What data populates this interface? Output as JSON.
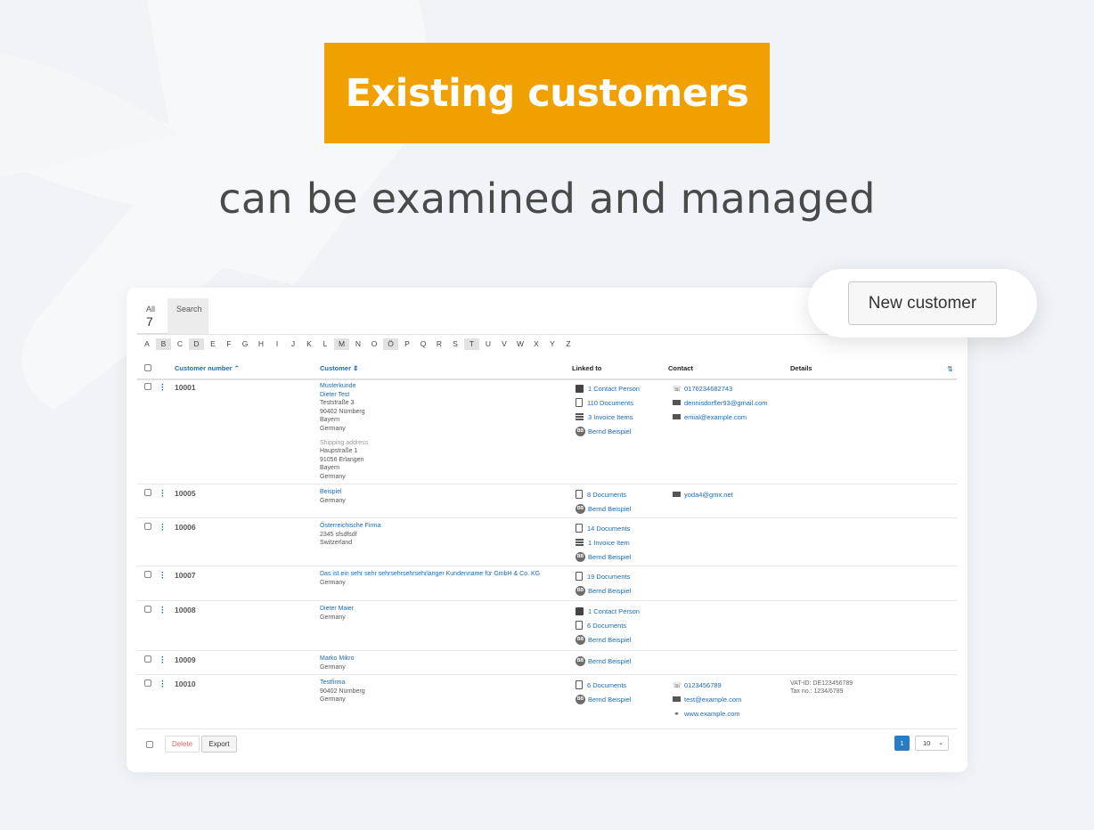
{
  "hero": {
    "title": "Existing customers",
    "subtitle": "can be examined and managed"
  },
  "colors": {
    "accent": "#f0a000",
    "link": "#1a6bb5",
    "primary_button": "#2a7bc4"
  },
  "new_customer_label": "New customer",
  "tabs": [
    {
      "label": "All",
      "count": "7"
    },
    {
      "label": "Search"
    }
  ],
  "letters": [
    "A",
    "B",
    "C",
    "D",
    "E",
    "F",
    "G",
    "H",
    "I",
    "J",
    "K",
    "L",
    "M",
    "N",
    "O",
    "Ö",
    "P",
    "Q",
    "R",
    "S",
    "T",
    "U",
    "V",
    "W",
    "X",
    "Y",
    "Z"
  ],
  "active_letters": [
    "B",
    "D",
    "M",
    "Ö",
    "T"
  ],
  "columns": {
    "customer_number": "Customer number ⌃",
    "customer": "Customer ⇕",
    "linked_to": "Linked to",
    "contact": "Contact",
    "details": "Details"
  },
  "rows": [
    {
      "number": "10001",
      "name_lines": [
        "Musterkunde",
        "Dieter Test"
      ],
      "address": [
        "Teststraße 3",
        "90402 Nürnberg",
        "Bayern",
        "Germany"
      ],
      "shipping_label": "Shipping address",
      "shipping": [
        "Haupstraße 1",
        "91056 Erlangen",
        "Bayern",
        "Germany"
      ],
      "links": [
        {
          "icon": "person-icon",
          "text": "1 Contact Person"
        },
        {
          "icon": "document-icon",
          "text": "110 Documents"
        },
        {
          "icon": "invoice-items-icon",
          "text": "3 Invoice Items"
        },
        {
          "icon": "avatar",
          "initials": "BB",
          "text": "Bernd Beispiel"
        }
      ],
      "contacts": [
        {
          "icon": "phone-icon",
          "text": "0176234682743"
        },
        {
          "icon": "mail-icon",
          "text": "dennisdorfler93@gmail.com"
        },
        {
          "icon": "mail-icon",
          "text": "emial@example.com"
        }
      ],
      "details": []
    },
    {
      "number": "10005",
      "name_lines": [
        "Beispiel"
      ],
      "address": [
        "Germany"
      ],
      "links": [
        {
          "icon": "document-icon",
          "text": "8 Documents"
        },
        {
          "icon": "avatar",
          "initials": "BB",
          "text": "Bernd Beispiel"
        }
      ],
      "contacts": [
        {
          "icon": "mail-icon",
          "text": "yoda4@gmx.net"
        }
      ],
      "details": []
    },
    {
      "number": "10006",
      "name_lines": [
        "Österreichische Firma"
      ],
      "address": [
        "2345 sfsdfsdf",
        "Switzerland"
      ],
      "links": [
        {
          "icon": "document-icon",
          "text": "14 Documents"
        },
        {
          "icon": "invoice-items-icon",
          "text": "1 Invoice Item"
        },
        {
          "icon": "avatar",
          "initials": "BB",
          "text": "Bernd Beispiel"
        }
      ],
      "contacts": [],
      "details": []
    },
    {
      "number": "10007",
      "name_lines": [
        "Das ist ein sehr sehr sehrsehrsehrsehrlanger Kundenname für GmbH & Co. KG"
      ],
      "address": [
        "Germany"
      ],
      "links": [
        {
          "icon": "document-icon",
          "text": "19 Documents"
        },
        {
          "icon": "avatar",
          "initials": "BB",
          "text": "Bernd Beispiel"
        }
      ],
      "contacts": [],
      "details": []
    },
    {
      "number": "10008",
      "name_lines": [
        "Dieter Maier"
      ],
      "address": [
        "Germany"
      ],
      "links": [
        {
          "icon": "person-icon",
          "text": "1 Contact Person"
        },
        {
          "icon": "document-icon",
          "text": "6 Documents"
        },
        {
          "icon": "avatar",
          "initials": "BB",
          "text": "Bernd Beispiel"
        }
      ],
      "contacts": [],
      "details": []
    },
    {
      "number": "10009",
      "name_lines": [
        "Marko Mikro"
      ],
      "address": [
        "Germany"
      ],
      "links": [
        {
          "icon": "avatar",
          "initials": "BB",
          "text": "Bernd Beispiel"
        }
      ],
      "contacts": [],
      "details": []
    },
    {
      "number": "10010",
      "name_lines": [
        "Testfirma"
      ],
      "address": [
        "90402 Nürnberg",
        "Germany"
      ],
      "links": [
        {
          "icon": "document-icon",
          "text": "6 Documents"
        },
        {
          "icon": "avatar",
          "initials": "BB",
          "text": "Bernd Beispiel"
        }
      ],
      "contacts": [
        {
          "icon": "phone-icon",
          "text": "0123456789"
        },
        {
          "icon": "mail-icon",
          "text": "test@example.com"
        },
        {
          "icon": "link-icon",
          "text": "www.example.com"
        }
      ],
      "details": [
        "VAT-ID: DE123456789",
        "Tax no.: 1234/6789"
      ]
    }
  ],
  "footer": {
    "delete_label": "Delete",
    "export_label": "Export",
    "current_page": "1",
    "per_page": "10"
  }
}
